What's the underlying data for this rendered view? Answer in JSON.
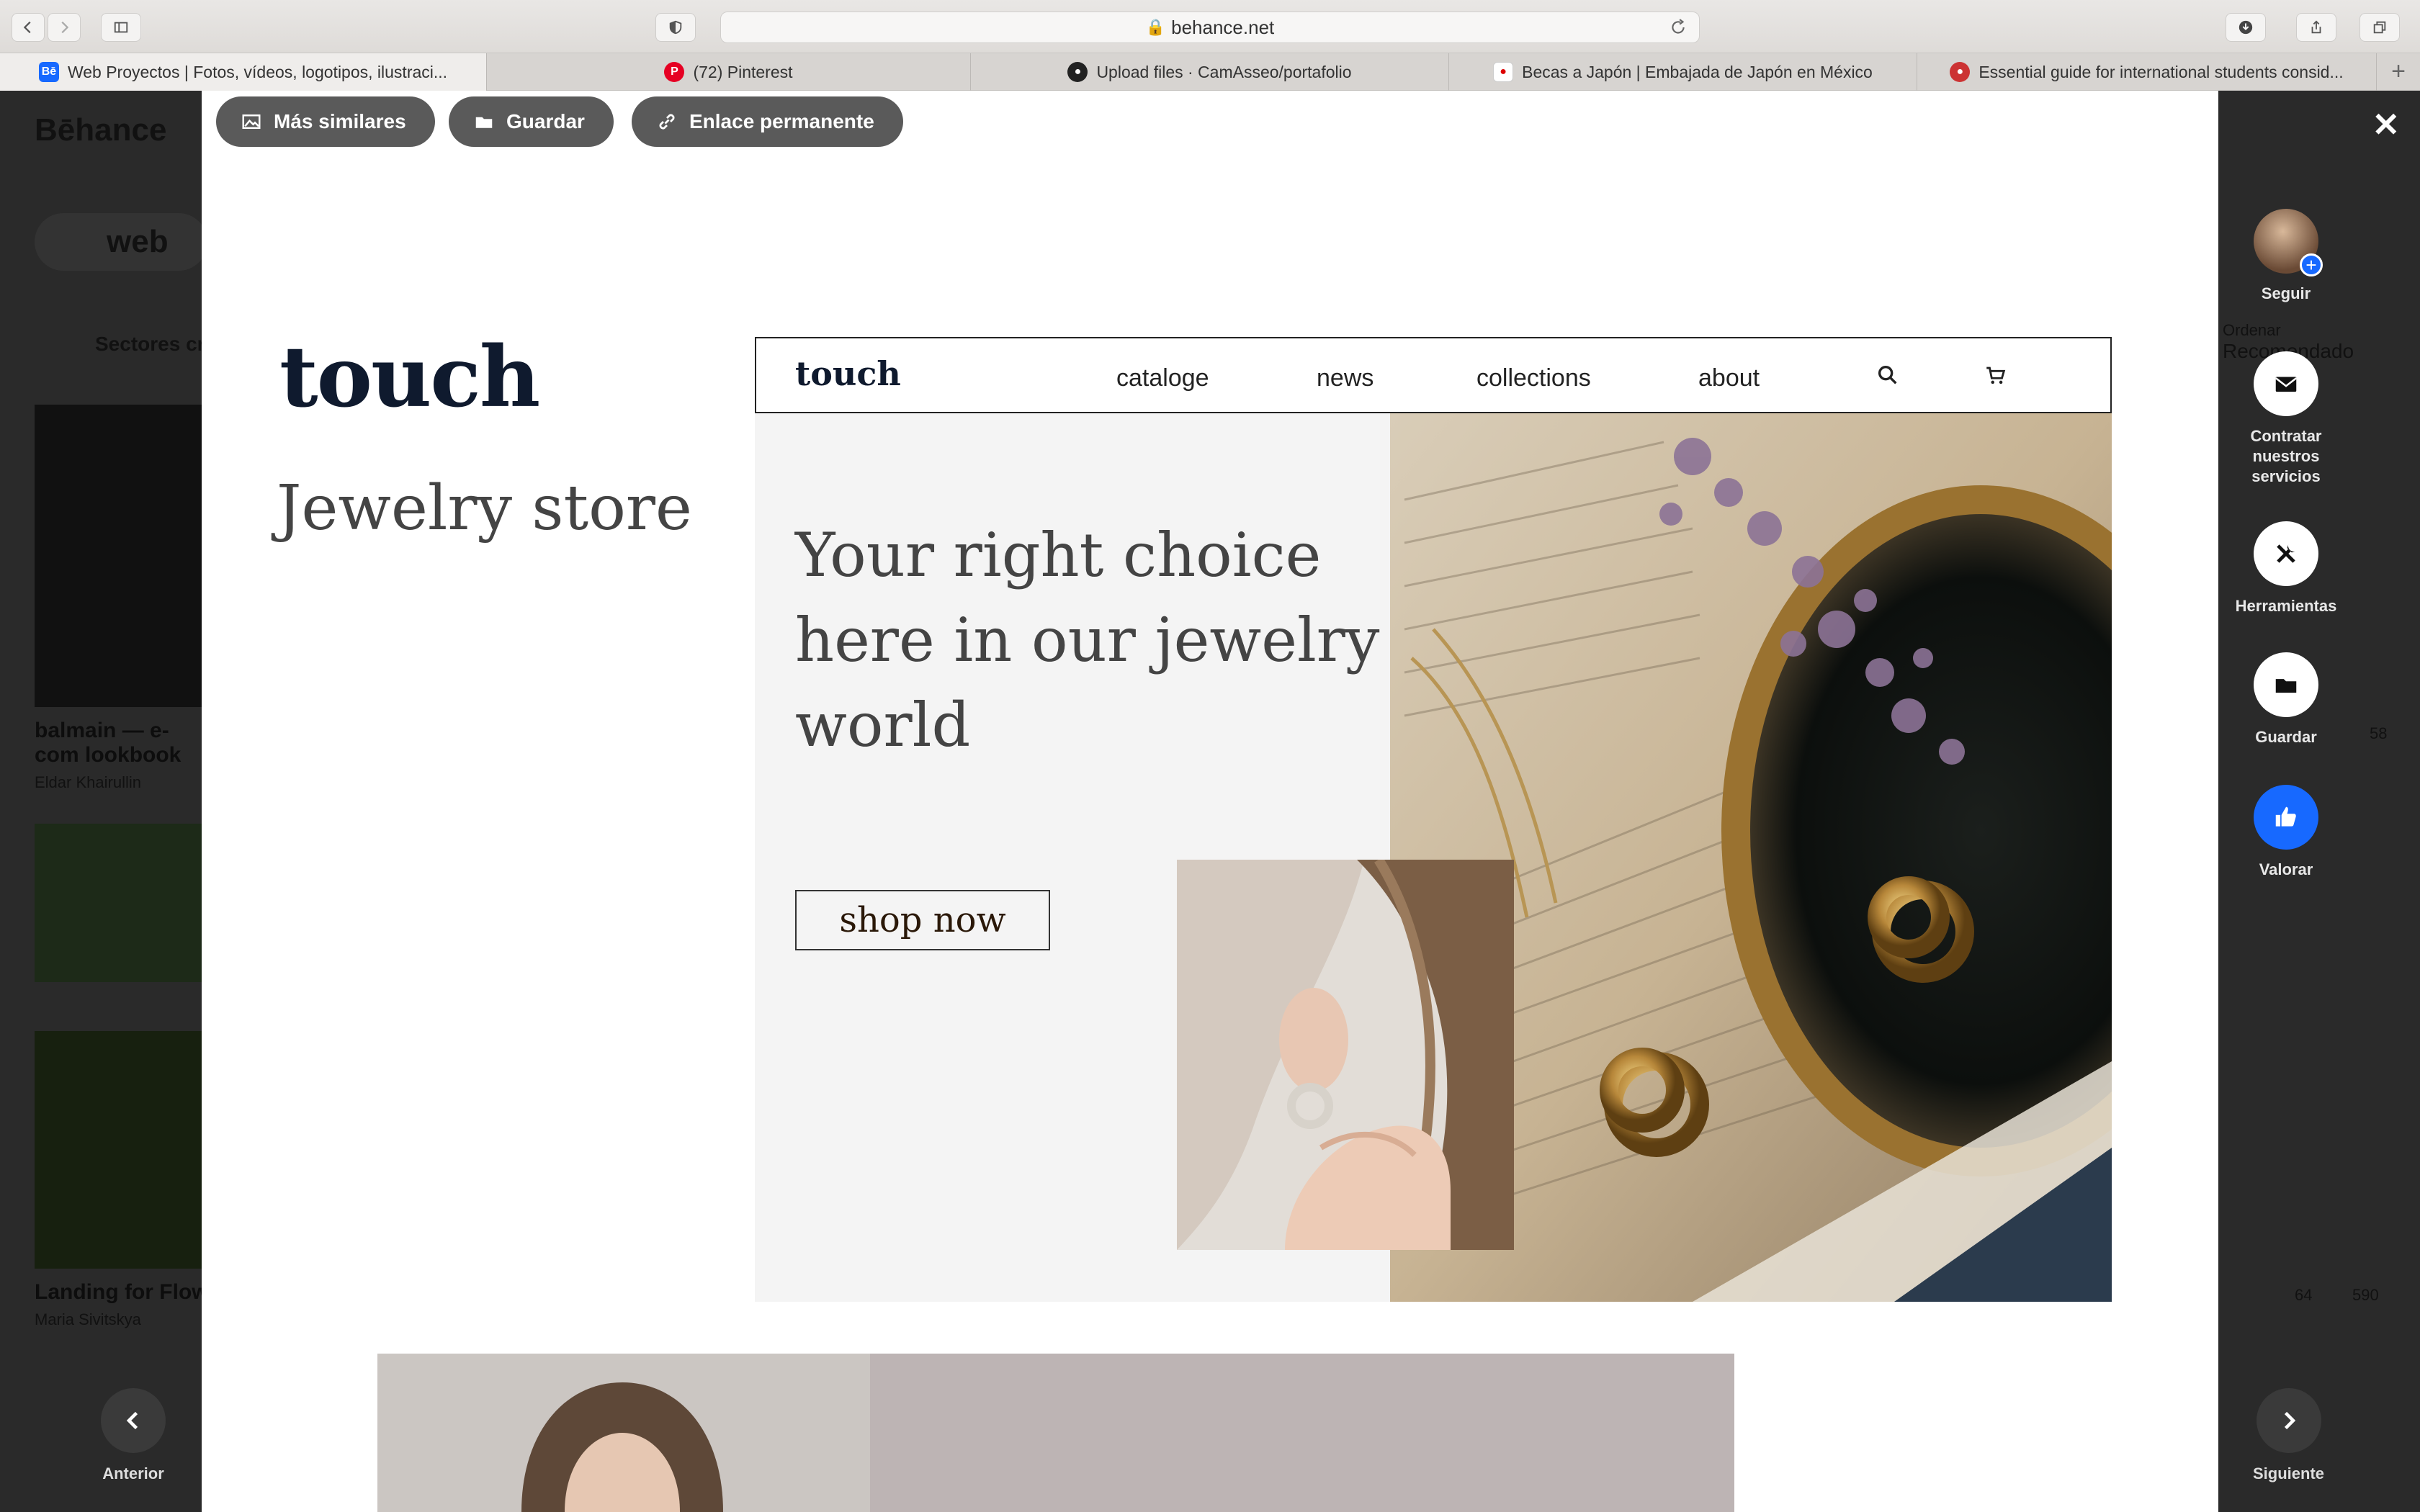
{
  "browser": {
    "url": "behance.net",
    "tabs": [
      {
        "title": "Web Proyectos | Fotos, vídeos, logotipos, ilustraci...",
        "icon": "behance-favicon-icon",
        "active": true
      },
      {
        "title": "(72) Pinterest",
        "icon": "pinterest-favicon-icon",
        "active": false
      },
      {
        "title": "Upload files · CamAsseo/portafolio",
        "icon": "github-favicon-icon",
        "active": false
      },
      {
        "title": "Becas a Japón | Embajada de Japón en México",
        "icon": "japan-flag-favicon-icon",
        "active": false
      },
      {
        "title": "Essential guide for international students consid...",
        "icon": "site-favicon-icon",
        "active": false
      }
    ]
  },
  "background_page": {
    "logo": "Bēhance",
    "search_value": "web",
    "sectors_label": "Sectores cr",
    "cards": [
      {
        "title": "balmain — e-com lookbook",
        "author": "Eldar Khairullin"
      },
      {
        "title": "Landing for Flow",
        "author": "Maria Sivitskya"
      }
    ],
    "stats": {
      "likes_a": "58",
      "likes_b": "64",
      "views_b": "590"
    },
    "sort_label": "Ordenar",
    "sort_value": "Recomendado"
  },
  "modal": {
    "toolbar": {
      "more_similar": "Más similares",
      "save": "Guardar",
      "permalink": "Enlace permanente"
    },
    "project": {
      "brand": "touch",
      "subtitle": "Jewelry store",
      "mockup": {
        "logo": "touch",
        "nav": [
          "cataloge",
          "news",
          "collections",
          "about"
        ],
        "hero_title": "Your right choice here in our jewelry world",
        "cta": "shop now"
      }
    }
  },
  "rail": {
    "follow": "Seguir",
    "hire": "Contratar nuestros servicios",
    "tools": "Herramientas",
    "save": "Guardar",
    "appreciate": "Valorar",
    "prev": "Anterior",
    "next": "Siguiente"
  },
  "colors": {
    "accent_blue": "#1769ff",
    "brand_navy": "#0f1a2e",
    "pill_gray": "#5a5a5a"
  }
}
